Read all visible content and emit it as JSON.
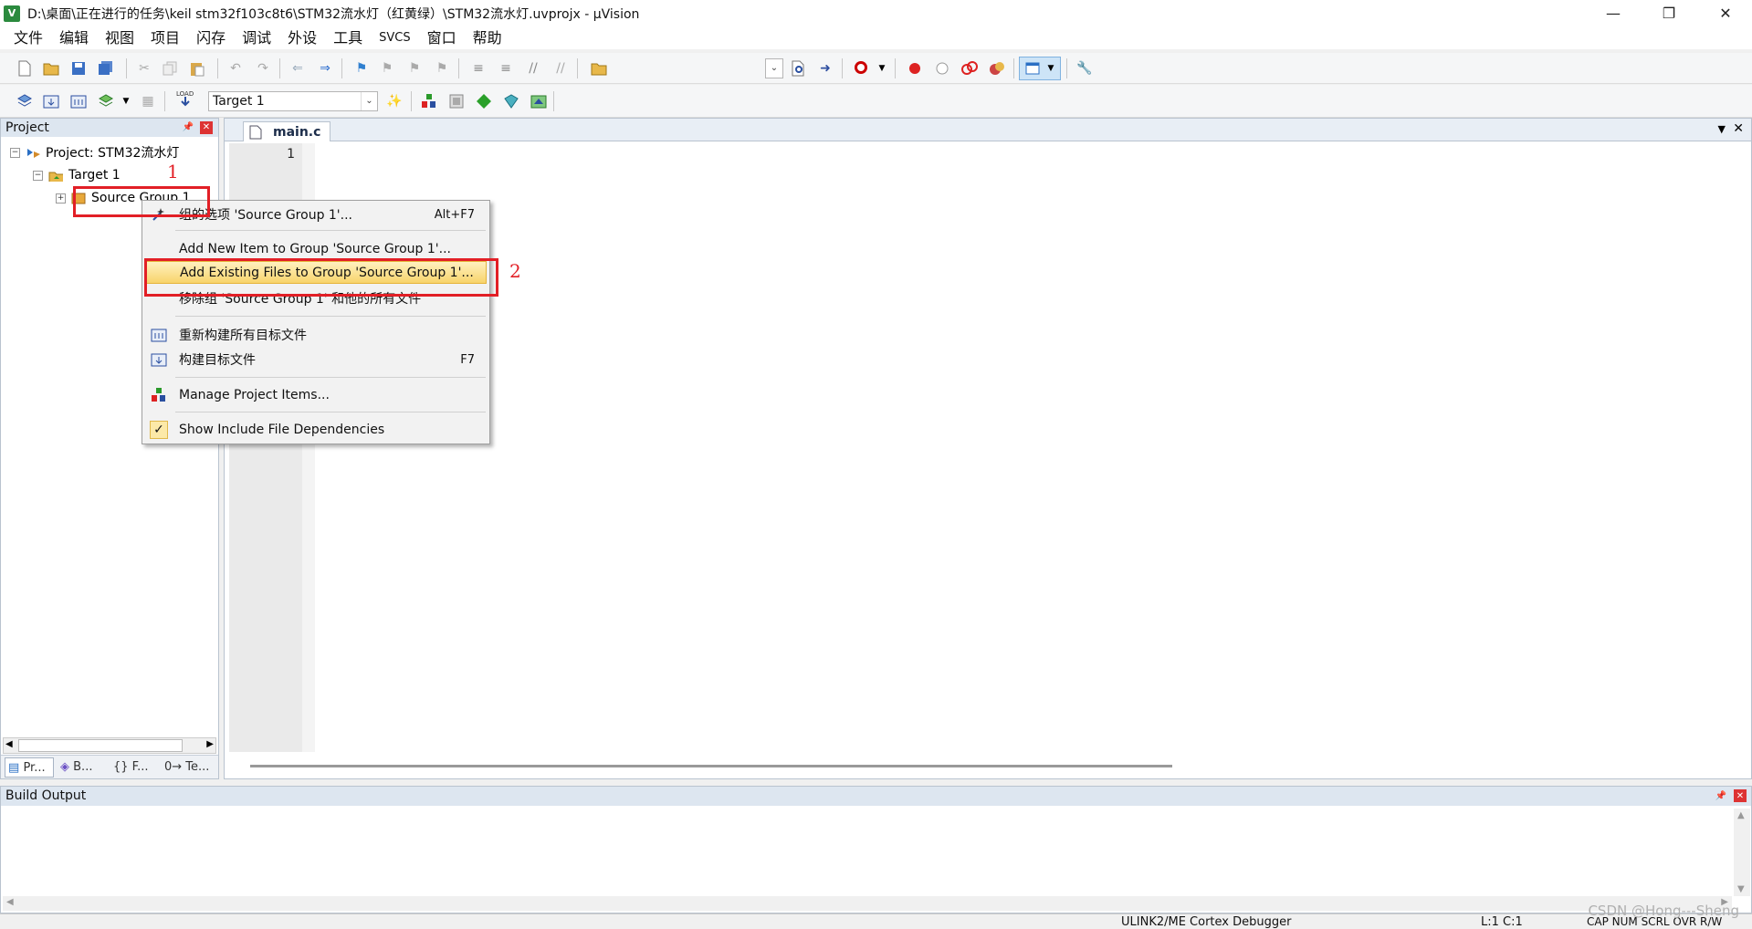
{
  "window": {
    "title": "D:\\桌面\\正在进行的任务\\keil stm32f103c8t6\\STM32流水灯（红黄绿）\\STM32流水灯.uvprojx - µVision",
    "app_icon_letter": "V"
  },
  "menu": [
    "文件",
    "编辑",
    "视图",
    "项目",
    "闪存",
    "调试",
    "外设",
    "工具",
    "SVCS",
    "窗口",
    "帮助"
  ],
  "toolbar": {
    "target_combo": "Target 1",
    "load_label": "LOAD"
  },
  "project_panel": {
    "title": "Project",
    "tree": {
      "project": "Project: STM32流水灯",
      "target": "Target 1",
      "group": "Source Group 1"
    },
    "tabs": [
      "Pr...",
      "B...",
      "{} F...",
      "0→ Te..."
    ]
  },
  "editor": {
    "tab": "main.c",
    "line_numbers": [
      "1"
    ]
  },
  "context_menu": {
    "items": [
      {
        "label": "组的选项 'Source Group 1'...",
        "shortcut": "Alt+F7",
        "icon": "options-icon"
      },
      {
        "label": "Add New  Item to Group 'Source Group 1'...",
        "shortcut": "",
        "icon": ""
      },
      {
        "label": "Add Existing Files to Group 'Source Group 1'...",
        "shortcut": "",
        "icon": "",
        "highlighted": true
      },
      {
        "label": "移除组 'Source Group 1' 和他的所有文件",
        "shortcut": "",
        "icon": ""
      },
      {
        "label": "重新构建所有目标文件",
        "shortcut": "",
        "icon": "rebuild-icon"
      },
      {
        "label": "构建目标文件",
        "shortcut": "F7",
        "icon": "build-icon"
      },
      {
        "label": "Manage Project Items...",
        "shortcut": "",
        "icon": "manage-items-icon"
      },
      {
        "label": "Show Include File Dependencies",
        "shortcut": "",
        "icon": "check-icon"
      }
    ]
  },
  "annotations": {
    "marker_1": "1",
    "marker_2": "2"
  },
  "build_output": {
    "title": "Build Output"
  },
  "statusbar": {
    "debugger": "ULINK2/ME Cortex Debugger",
    "cursor": "L:1 C:1",
    "flags": "CAP  NUM  SCRL  OVR  R/W"
  },
  "watermark": "CSDN @Hong---Sheng",
  "colors": {
    "annotation_red": "#e21f26",
    "highlight_yellow": "#f8d46b",
    "panel_header": "#dde6f0"
  }
}
